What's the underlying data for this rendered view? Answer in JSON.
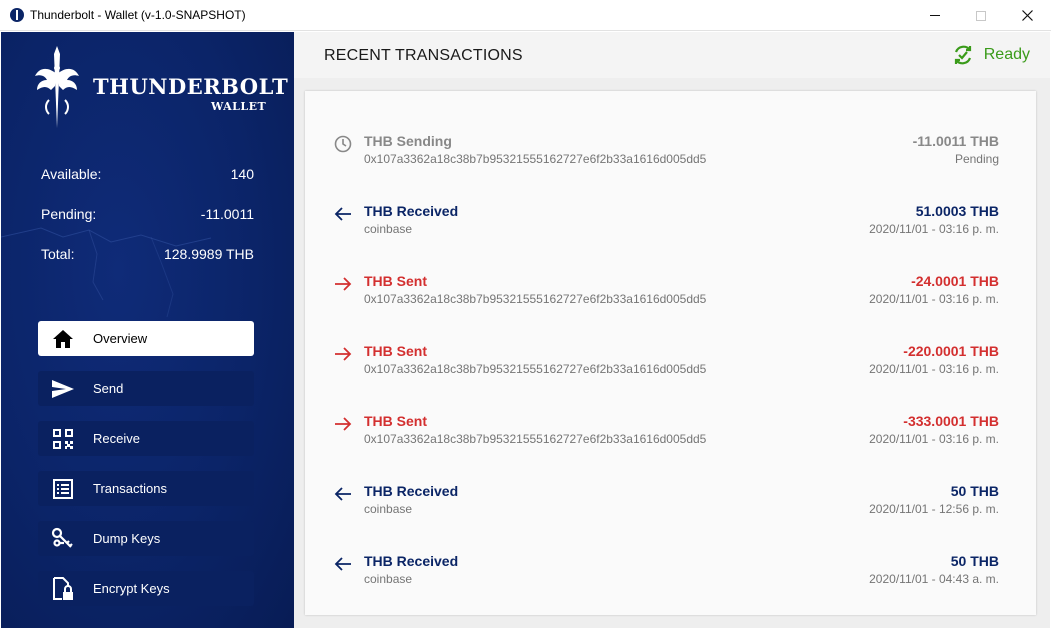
{
  "window": {
    "title": "Thunderbolt - Wallet (v-1.0-SNAPSHOT)"
  },
  "brand": {
    "name": "THUNDERBOLT",
    "subtitle": "WALLET"
  },
  "balances": {
    "available_label": "Available:",
    "available_value": "140",
    "pending_label": "Pending:",
    "pending_value": "-11.0011",
    "total_label": "Total:",
    "total_value": "128.9989 THB"
  },
  "nav": {
    "items": [
      {
        "label": "Overview",
        "icon": "home-icon",
        "active": true
      },
      {
        "label": "Send",
        "icon": "send-icon",
        "active": false
      },
      {
        "label": "Receive",
        "icon": "qr-code-icon",
        "active": false
      },
      {
        "label": "Transactions",
        "icon": "list-icon",
        "active": false
      },
      {
        "label": "Dump Keys",
        "icon": "keys-icon",
        "active": false
      },
      {
        "label": "Encrypt Keys",
        "icon": "file-lock-icon",
        "active": false
      }
    ]
  },
  "header": {
    "title": "RECENT TRANSACTIONS",
    "status": "Ready"
  },
  "transactions": [
    {
      "title": "THB Sending",
      "detail": "0x107a3362a18c38b7b95321555162727e6f2b33a1616d005dd5",
      "amount": "-11.0011 THB",
      "date": "Pending",
      "kind": "pending"
    },
    {
      "title": "THB Received",
      "detail": "coinbase",
      "amount": "51.0003 THB",
      "date": "2020/11/01 - 03:16 p. m.",
      "kind": "received"
    },
    {
      "title": "THB Sent",
      "detail": "0x107a3362a18c38b7b95321555162727e6f2b33a1616d005dd5",
      "amount": "-24.0001 THB",
      "date": "2020/11/01 - 03:16 p. m.",
      "kind": "sent"
    },
    {
      "title": "THB Sent",
      "detail": "0x107a3362a18c38b7b95321555162727e6f2b33a1616d005dd5",
      "amount": "-220.0001 THB",
      "date": "2020/11/01 - 03:16 p. m.",
      "kind": "sent"
    },
    {
      "title": "THB Sent",
      "detail": "0x107a3362a18c38b7b95321555162727e6f2b33a1616d005dd5",
      "amount": "-333.0001 THB",
      "date": "2020/11/01 - 03:16 p. m.",
      "kind": "sent"
    },
    {
      "title": "THB Received",
      "detail": "coinbase",
      "amount": "50 THB",
      "date": "2020/11/01 - 12:56 p. m.",
      "kind": "received"
    },
    {
      "title": "THB Received",
      "detail": "coinbase",
      "amount": "50 THB",
      "date": "2020/11/01 - 04:43 a. m.",
      "kind": "received"
    }
  ],
  "colors": {
    "sidebar": "#0b2468",
    "received": "#0b2566",
    "sent": "#d32f2f",
    "pending": "#888888",
    "status": "#3a9b1a"
  }
}
